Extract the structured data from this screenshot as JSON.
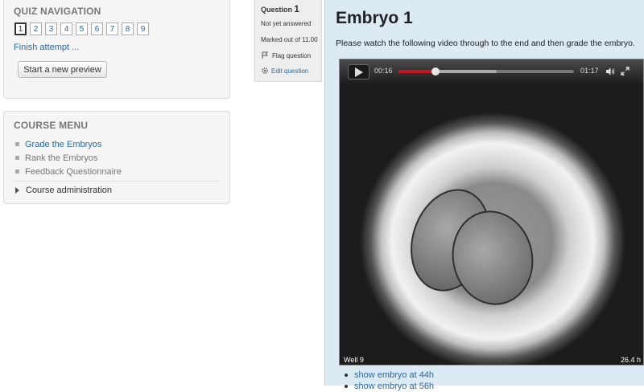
{
  "quiz_navigation": {
    "title": "QUIZ NAVIGATION",
    "questions": [
      "1",
      "2",
      "3",
      "4",
      "5",
      "6",
      "7",
      "8",
      "9"
    ],
    "current": "1",
    "finish_link": "Finish attempt ...",
    "new_preview_button": "Start a new preview"
  },
  "course_menu": {
    "title": "COURSE MENU",
    "items": [
      {
        "label": "Grade the Embryos"
      },
      {
        "label": "Rank the Embryos"
      },
      {
        "label": "Feedback Questionnaire"
      }
    ],
    "admin": "Course administration"
  },
  "question_info": {
    "label": "Question",
    "number": "1",
    "state": "Not yet answered",
    "marks": "Marked out of 11.00",
    "flag": "Flag question",
    "edit": "Edit question"
  },
  "question": {
    "title": "Embryo 1",
    "text": "Please watch the following video through to the end and then grade the embryo."
  },
  "video": {
    "current_time": "00:16",
    "duration": "01:17",
    "progress": 0.21,
    "buffered": 0.56,
    "overlay_left": "Well 9",
    "overlay_right": "26.4 h",
    "icons": [
      "play-icon",
      "volume-icon",
      "fullscreen-icon"
    ],
    "accent_color": "#c8141e"
  },
  "links": [
    {
      "label": "show embryo at 44h"
    },
    {
      "label": "show embryo at 56h"
    }
  ]
}
